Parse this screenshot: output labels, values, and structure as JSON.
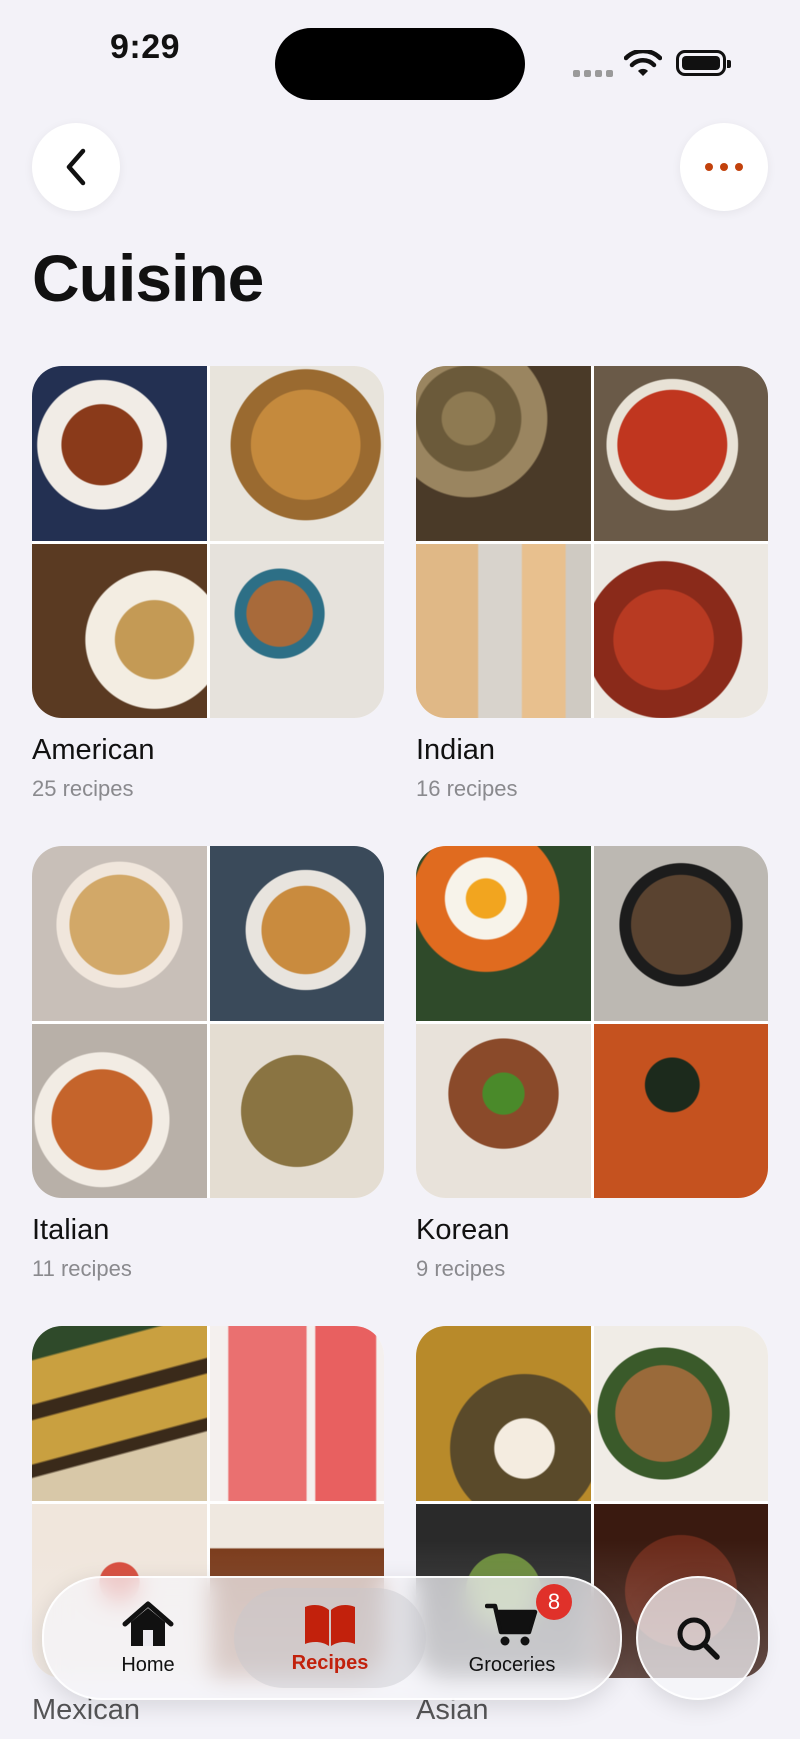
{
  "status_bar": {
    "time": "9:29"
  },
  "header": {
    "title": "Cuisine"
  },
  "colors": {
    "accent": "#c2410c",
    "tab_active": "#c2210c",
    "badge": "#e0312a"
  },
  "cuisines": [
    {
      "name": "American",
      "count": "25 recipes",
      "tiles": [
        "#6b3a22",
        "#b9823f",
        "#8a6b3a",
        "#7a8a55"
      ]
    },
    {
      "name": "Indian",
      "count": "16 recipes",
      "tiles": [
        "#7d6a45",
        "#b8321f",
        "#d9b98a",
        "#a8452a"
      ]
    },
    {
      "name": "Italian",
      "count": "11 recipes",
      "tiles": [
        "#c9a46a",
        "#c88a3e",
        "#c06a2f",
        "#8a7540"
      ]
    },
    {
      "name": "Korean",
      "count": "9 recipes",
      "tiles": [
        "#d8812a",
        "#4a3a2a",
        "#9a4a2a",
        "#c6521f"
      ]
    },
    {
      "name": "Mexican",
      "count": "",
      "tiles": [
        "#6b5a2a",
        "#e87070",
        "#e8b8a0",
        "#8a5a3a"
      ]
    },
    {
      "name": "Asian",
      "count": "",
      "tiles": [
        "#6a5a2a",
        "#8a6a3a",
        "#3a4a2a",
        "#5a2a1a"
      ]
    }
  ],
  "tabbar": {
    "home_label": "Home",
    "recipes_label": "Recipes",
    "groceries_label": "Groceries",
    "groceries_badge": "8"
  }
}
